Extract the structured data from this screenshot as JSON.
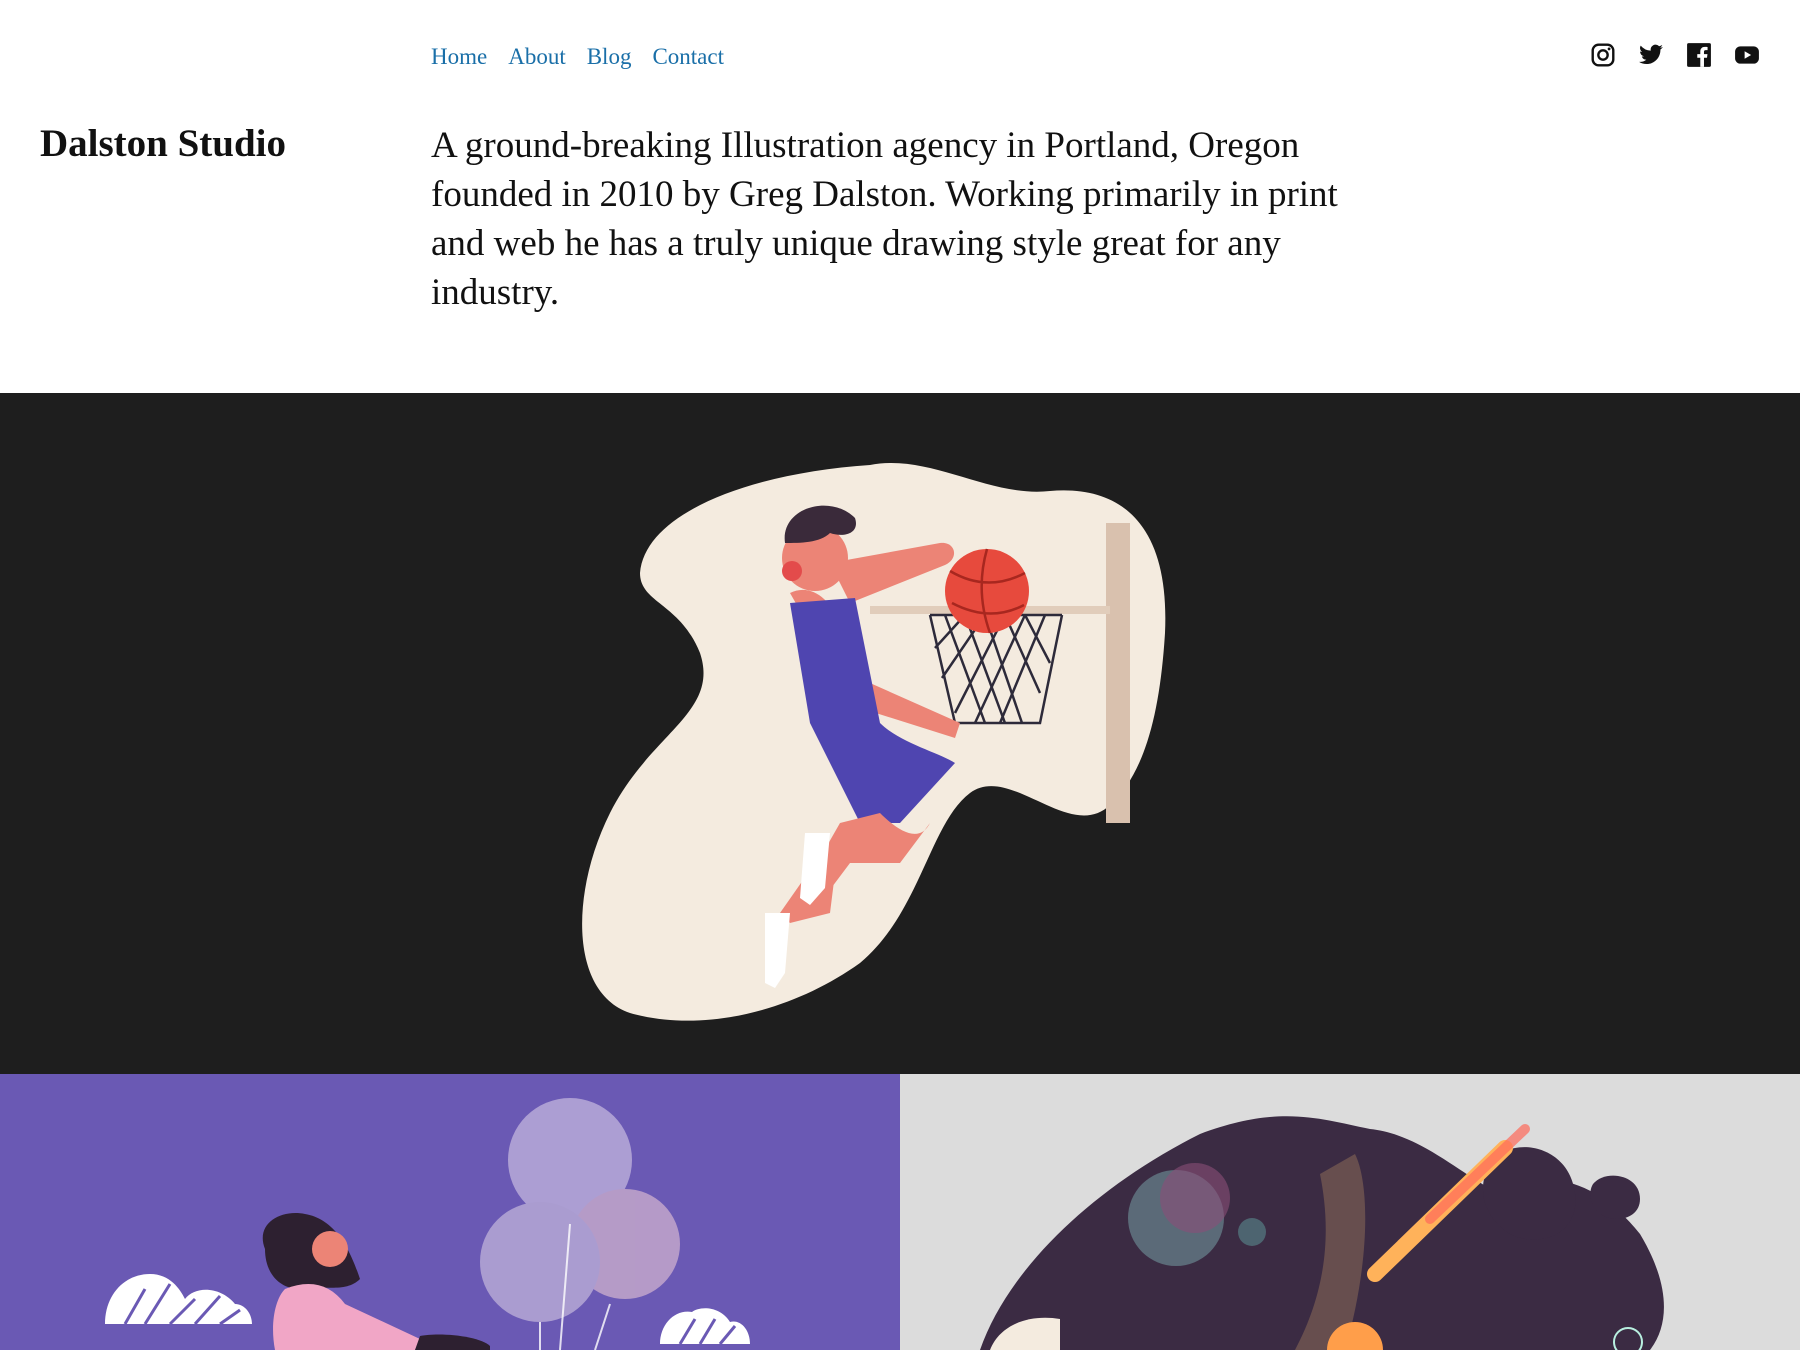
{
  "nav": {
    "items": [
      {
        "label": "Home"
      },
      {
        "label": "About"
      },
      {
        "label": "Blog"
      },
      {
        "label": "Contact"
      }
    ]
  },
  "social": [
    "instagram-icon",
    "twitter-icon",
    "facebook-icon",
    "youtube-icon"
  ],
  "site": {
    "title": "Dalston Studio",
    "intro": "A ground-breaking Illustration agency in Portland, Oregon founded in 2010 by Greg Dalston. Working primarily in print and web he has a truly unique drawing style great for any industry."
  },
  "colors": {
    "link": "#1a6fa8",
    "hero_bg": "#1e1e1e",
    "tile_left_bg": "#6a59b4",
    "tile_right_bg": "#dcdcdc"
  },
  "gallery": [
    {
      "subject": "basketball-dunk-illustration"
    },
    {
      "subject": "woman-with-balloons-illustration"
    },
    {
      "subject": "space-planets-illustration"
    }
  ]
}
